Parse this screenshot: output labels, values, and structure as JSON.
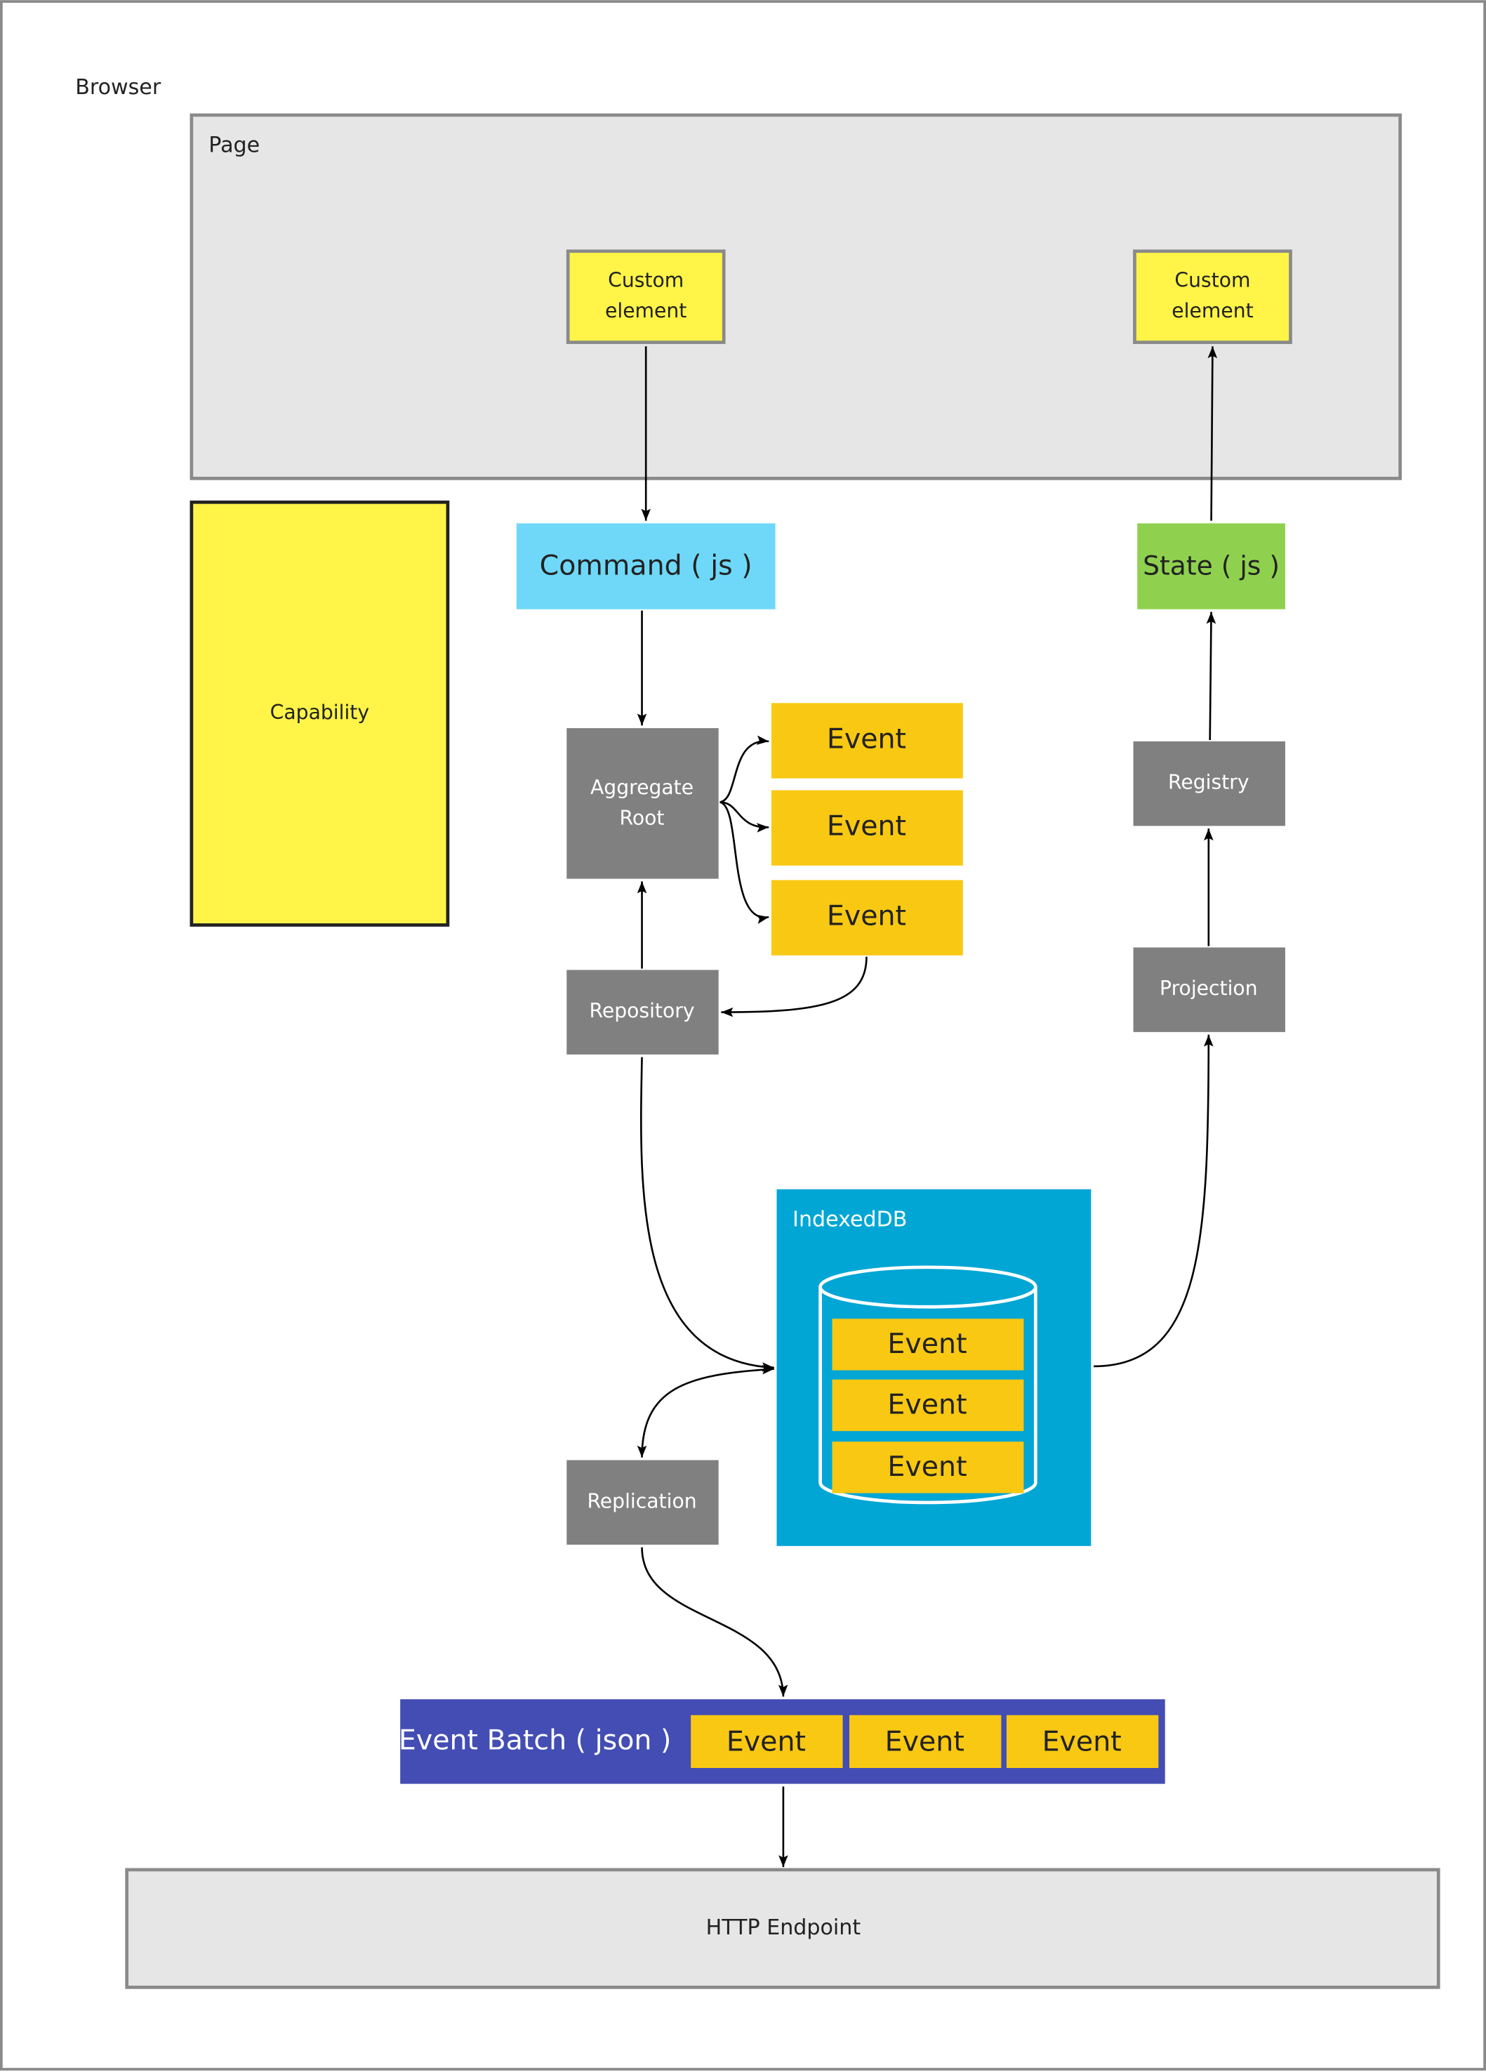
{
  "colors": {
    "frame_border": "#8a8a8a",
    "page_fill": "#e6e6e6",
    "custom_element_fill": "#fff447",
    "capability_fill": "#fff447",
    "command_fill": "#6fd8f8",
    "state_fill": "#8fd14f",
    "gray_box": "#808080",
    "event_fill": "#f8c813",
    "indexeddb_fill": "#01a6d5",
    "event_batch_fill": "#434db3",
    "http_fill": "#e6e6e6"
  },
  "browser": {
    "label": "Browser"
  },
  "page": {
    "label": "Page",
    "custom_element_left": {
      "line1": "Custom",
      "line2": "element"
    },
    "custom_element_right": {
      "line1": "Custom",
      "line2": "element"
    }
  },
  "capability": {
    "label": "Capability"
  },
  "command": {
    "label": "Command ( js )"
  },
  "state": {
    "label": "State ( js )"
  },
  "aggregate_root": {
    "line1": "Aggregate",
    "line2": "Root"
  },
  "events": [
    {
      "label": "Event"
    },
    {
      "label": "Event"
    },
    {
      "label": "Event"
    }
  ],
  "repository": {
    "label": "Repository"
  },
  "registry": {
    "label": "Registry"
  },
  "projection": {
    "label": "Projection"
  },
  "indexeddb": {
    "label": "IndexedDB",
    "events": [
      {
        "label": "Event"
      },
      {
        "label": "Event"
      },
      {
        "label": "Event"
      }
    ]
  },
  "replication": {
    "label": "Replication"
  },
  "event_batch": {
    "label": "Event Batch ( json )",
    "events": [
      {
        "label": "Event"
      },
      {
        "label": "Event"
      },
      {
        "label": "Event"
      }
    ]
  },
  "http_endpoint": {
    "label": "HTTP Endpoint"
  }
}
